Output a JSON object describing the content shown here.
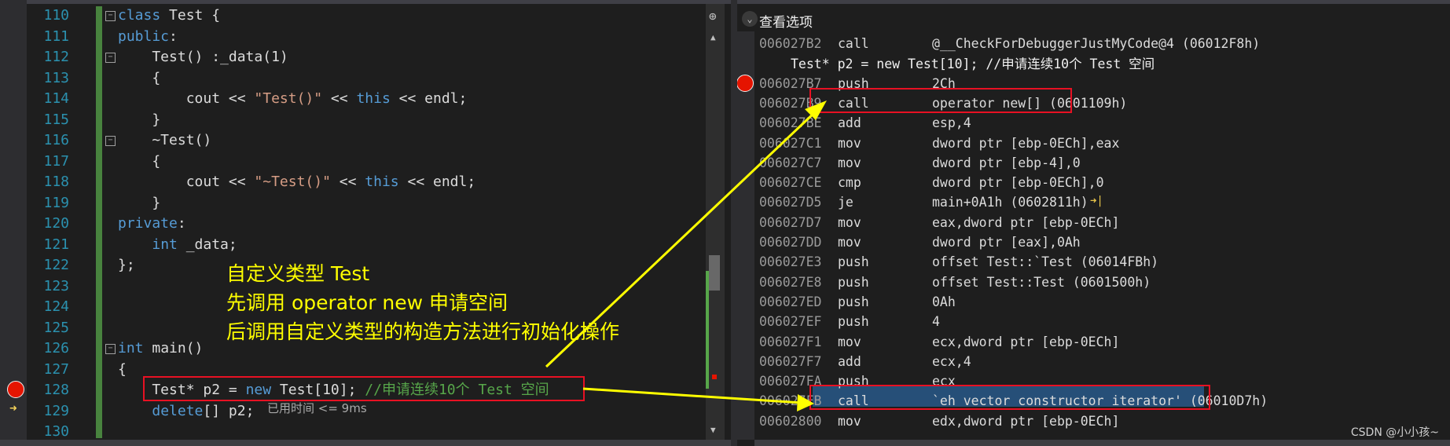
{
  "source_editor": {
    "lines": [
      {
        "num": "110",
        "html": "<span class=\"kw\">class</span> Test {"
      },
      {
        "num": "111",
        "html": "<span class=\"kw\">public</span>:"
      },
      {
        "num": "112",
        "html": "    Test() :_data(1)"
      },
      {
        "num": "113",
        "html": "    {"
      },
      {
        "num": "114",
        "html": "        cout &lt;&lt; <span class=\"str\">\"Test()\"</span> &lt;&lt; <span class=\"kw\">this</span> &lt;&lt; endl;"
      },
      {
        "num": "115",
        "html": "    }"
      },
      {
        "num": "116",
        "html": "    ~Test()"
      },
      {
        "num": "117",
        "html": "    {"
      },
      {
        "num": "118",
        "html": "        cout &lt;&lt; <span class=\"str\">\"~Test()\"</span> &lt;&lt; <span class=\"kw\">this</span> &lt;&lt; endl;"
      },
      {
        "num": "119",
        "html": "    }"
      },
      {
        "num": "120",
        "html": "<span class=\"kw\">private</span>:"
      },
      {
        "num": "121",
        "html": "    <span class=\"kw\">int</span> _data;"
      },
      {
        "num": "122",
        "html": "};"
      },
      {
        "num": "123",
        "html": ""
      },
      {
        "num": "124",
        "html": ""
      },
      {
        "num": "125",
        "html": ""
      },
      {
        "num": "126",
        "html": "<span class=\"kw\">int</span> main()"
      },
      {
        "num": "127",
        "html": "{"
      },
      {
        "num": "128",
        "html": "    Test* p2 = <span class=\"kw\">new</span> Test[10]; <span class=\"cmt\">//申请连续10个 Test 空间</span>"
      },
      {
        "num": "129",
        "html": "    <span class=\"kw\">delete</span>[] p2;"
      },
      {
        "num": "130",
        "html": ""
      }
    ],
    "elapsed_hint": "已用时间 <= 9ms"
  },
  "annotation": {
    "line1": "自定义类型 Test",
    "line2": "先调用 operator new 申请空间",
    "line3": "后调用自定义类型的构造方法进行初始化操作"
  },
  "disassembly": {
    "view_options_label": "查看选项",
    "rows": [
      {
        "addr": "006027B2",
        "mn": "call",
        "op": "@__CheckForDebuggerJustMyCode@4 (06012F8h)"
      },
      {
        "src": "Test* p2 = new Test[10]; //申请连续10个 Test 空间"
      },
      {
        "addr": "006027B7",
        "mn": "push",
        "op": "2Ch"
      },
      {
        "addr": "006027B9",
        "mn": "call",
        "op": "operator new[] (0601109h)"
      },
      {
        "addr": "006027BE",
        "mn": "add",
        "op": "esp,4"
      },
      {
        "addr": "006027C1",
        "mn": "mov",
        "op": "dword ptr [ebp-0ECh],eax"
      },
      {
        "addr": "006027C7",
        "mn": "mov",
        "op": "dword ptr [ebp-4],0"
      },
      {
        "addr": "006027CE",
        "mn": "cmp",
        "op": "dword ptr [ebp-0ECh],0"
      },
      {
        "addr": "006027D5",
        "mn": "je",
        "op": "main+0A1h (0602811h)"
      },
      {
        "addr": "006027D7",
        "mn": "mov",
        "op": "eax,dword ptr [ebp-0ECh]"
      },
      {
        "addr": "006027DD",
        "mn": "mov",
        "op": "dword ptr [eax],0Ah"
      },
      {
        "addr": "006027E3",
        "mn": "push",
        "op": "offset Test::`Test (06014FBh)"
      },
      {
        "addr": "006027E8",
        "mn": "push",
        "op": "offset Test::Test (0601500h)"
      },
      {
        "addr": "006027ED",
        "mn": "push",
        "op": "0Ah"
      },
      {
        "addr": "006027EF",
        "mn": "push",
        "op": "4"
      },
      {
        "addr": "006027F1",
        "mn": "mov",
        "op": "ecx,dword ptr [ebp-0ECh]"
      },
      {
        "addr": "006027F7",
        "mn": "add",
        "op": "ecx,4"
      },
      {
        "addr": "006027FA",
        "mn": "push",
        "op": "ecx"
      },
      {
        "addr": "006027FB",
        "mn": "call",
        "op": "`eh vector constructor iterator' (06010D7h)"
      },
      {
        "addr": "00602800",
        "mn": "mov",
        "op": "edx,dword ptr [ebp-0ECh]"
      }
    ]
  },
  "watermark": "CSDN @小小孩~",
  "colors": {
    "arrow": "#ffff00",
    "highlight_box": "#e81123",
    "breakpoint": "#e51400"
  }
}
